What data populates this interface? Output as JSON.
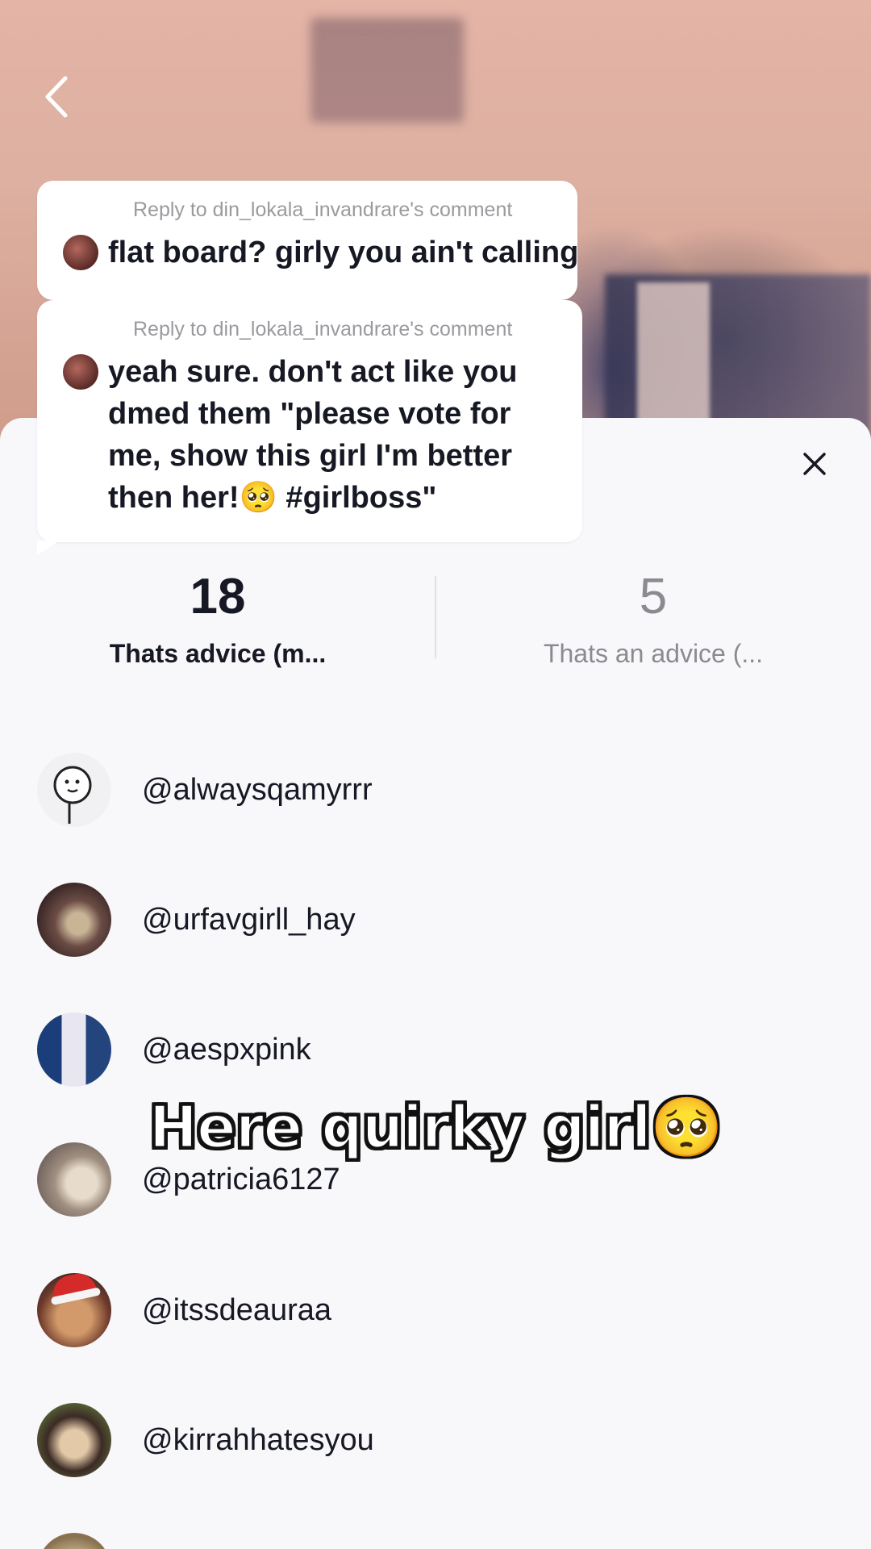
{
  "nav": {
    "back_icon": "chevron-left-icon"
  },
  "stickers": [
    {
      "reply_to": "Reply to din_lokala_invandrare's comment",
      "text": "flat board? girly you ain't calling something as a \"flat"
    },
    {
      "reply_to": "Reply to din_lokala_invandrare's comment",
      "text": "yeah sure. don't act like you dmed them \"please vote for me, show this girl I'm better then her!🥺 #girlboss\""
    }
  ],
  "sheet": {
    "close_icon": "close-icon",
    "poll": {
      "option_1": {
        "count": "18",
        "label": "Thats advice (m..."
      },
      "option_2": {
        "count": "5",
        "label": "Thats an advice (..."
      }
    },
    "voters": [
      "@alwaysqamyrrr",
      "@urfavgirll_hay",
      "@aespxpink",
      "@patricia6127",
      "@itssdeauraa",
      "@kirrahhatesyou"
    ]
  },
  "overlay_caption": "Here quirky girl🥺",
  "colors": {
    "sheet_bg": "#f8f7fa",
    "primary_text": "#161823",
    "secondary_text": "#8a8b91"
  }
}
